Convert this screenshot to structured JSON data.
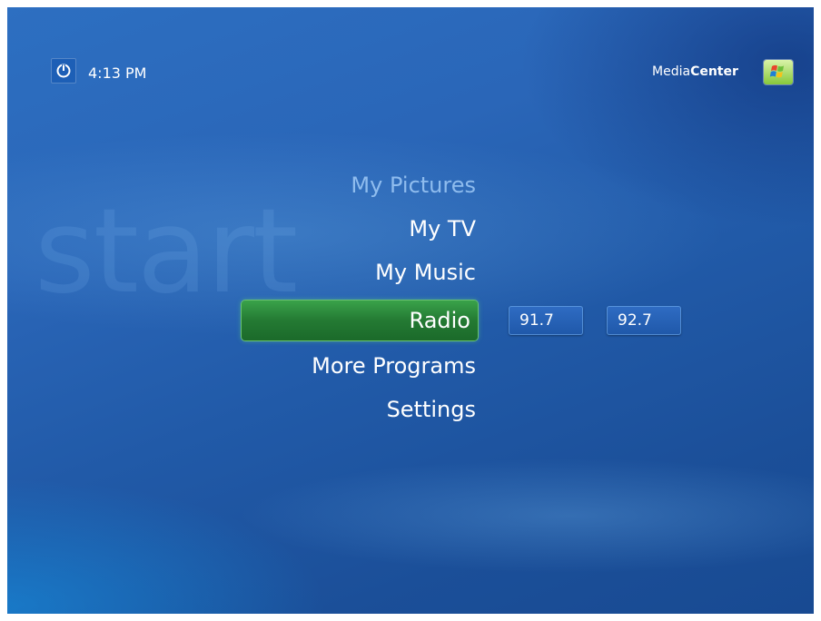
{
  "bg_word": "start",
  "header": {
    "time": "4:13 PM",
    "brand_regular": "Media",
    "brand_bold": "Center"
  },
  "menu": {
    "items": [
      {
        "label": "My Pictures",
        "state": "faded"
      },
      {
        "label": "My TV"
      },
      {
        "label": "My Music"
      },
      {
        "label": "Radio",
        "state": "selected"
      },
      {
        "label": "More Programs"
      },
      {
        "label": "Settings"
      }
    ]
  },
  "radio": {
    "stations": [
      "91.7",
      "92.7"
    ]
  },
  "colors": {
    "selected_green": "#247a33",
    "background_blue": "#2a66b8",
    "station_blue": "#1f58a9"
  },
  "icons": {
    "power": "power-icon",
    "logo": "windows-logo-icon"
  }
}
